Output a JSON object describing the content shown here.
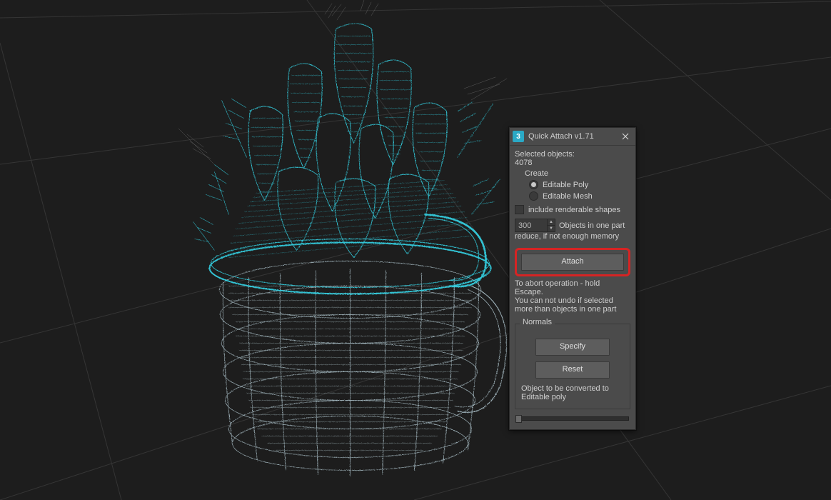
{
  "dialog": {
    "title": "Quick Attach v1.71",
    "selected_label": "Selected objects:",
    "selected_count": "4078",
    "create_label": "Create",
    "radio_poly": "Editable Poly",
    "radio_mesh": "Editable Mesh",
    "radio_selected": "poly",
    "include_shapes": "include renderable shapes",
    "spinner_value": "300",
    "spinner_hint1": "Objects in one part",
    "spinner_hint2": "reduce, if not enough memory",
    "attach_label": "Attach",
    "abort_line1": "To abort operation - hold Escape.",
    "abort_line2": "You can not undo if selected",
    "abort_line3": "more than objects in one part",
    "normals_label": "Normals",
    "specify_label": "Specify",
    "reset_label": "Reset",
    "convert_line1": "Object to be converted to",
    "convert_line2": "Editable poly"
  },
  "colors": {
    "wire_selected": "#35d6e8",
    "wire_unselected": "#7a7a7a",
    "highlight_border": "#d62424"
  }
}
